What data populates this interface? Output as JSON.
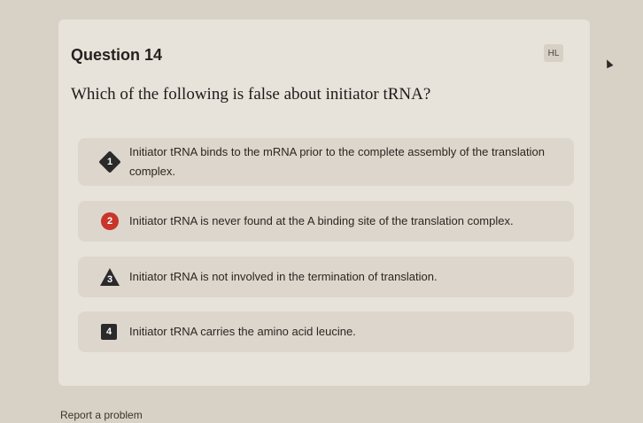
{
  "question": {
    "title": "Question 14",
    "level_badge": "HL",
    "prompt": "Which of the following is false about initiator tRNA?"
  },
  "options": [
    {
      "number": "1",
      "shape": "diamond",
      "text": "Initiator tRNA binds to the mRNA prior to the complete assembly of the translation complex."
    },
    {
      "number": "2",
      "shape": "circle",
      "text": "Initiator tRNA is never found at the A binding site of the translation complex."
    },
    {
      "number": "3",
      "shape": "triangle",
      "text": "Initiator tRNA is not involved in the termination of translation."
    },
    {
      "number": "4",
      "shape": "square",
      "text": "Initiator tRNA carries the amino acid leucine."
    }
  ],
  "footer": {
    "report_label": "Report a problem"
  },
  "colors": {
    "background": "#d8d1c5",
    "card": "#e7e2da",
    "option": "#ddd6cc",
    "accent_red": "#c8352b"
  }
}
